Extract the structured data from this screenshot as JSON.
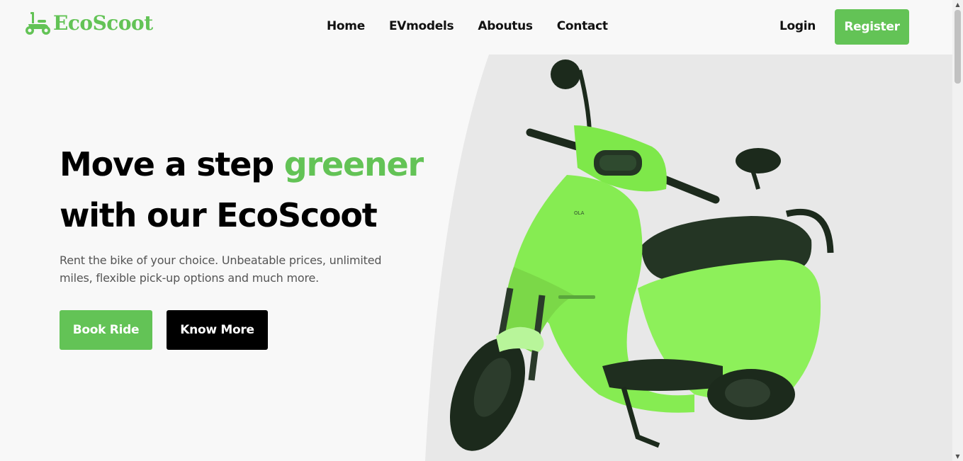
{
  "brand": {
    "name": "EcoScoot",
    "icon": "scooter-icon",
    "accent": "#63c356"
  },
  "nav": {
    "links": [
      "Home",
      "EVmodels",
      "Aboutus",
      "Contact"
    ],
    "login": "Login",
    "register": "Register"
  },
  "hero": {
    "title_part1": "Move a step ",
    "title_highlight": "greener",
    "title_part2": "with our EcoScoot",
    "description": "Rent the bike of your choice. Unbeatable prices, unlimited miles, flexible pick-up options and much more.",
    "book_button": "Book Ride",
    "more_button": "Know More",
    "image": "green-electric-scooter",
    "image_bg": "#e8e8e8"
  }
}
